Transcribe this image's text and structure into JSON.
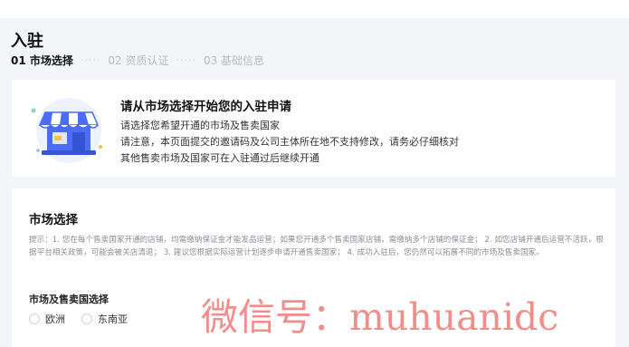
{
  "header": {
    "title": "入驻",
    "steps": [
      {
        "label": "01 市场选择",
        "active": true
      },
      {
        "label": "02 资质认证",
        "active": false
      },
      {
        "label": "03 基础信息",
        "active": false
      }
    ],
    "step_separator": "·····"
  },
  "intro": {
    "heading": "请从市场选择开始您的入驻申请",
    "lines": [
      "请选择您希望开通的市场及售卖国家",
      "请注意，本页面提交的邀请码及公司主体所在地不支持修改，请务必仔细核对",
      "其他售卖市场及国家可在入驻通过后继续开通"
    ],
    "illustration": "storefront-icon"
  },
  "market": {
    "title": "市场选择",
    "hint": "提示：1. 您在每个售卖国家开通的店铺，均需缴纳保证金才能发品运营；如果您开通多个售卖国家店铺，需缴纳多个店铺的保证金； 2. 如您店铺开通后运营不活跃，根据平台相关政策，可能会被关店清退； 3. 建议您根据实际运营计划逐步申请开通售卖国家； 4. 成功入驻后，您仍然可以拓展不同的市场及售卖国家。",
    "region_label": "市场及售卖国选择",
    "options": [
      {
        "label": "欧洲",
        "selected": false
      },
      {
        "label": "东南亚",
        "selected": false
      }
    ]
  },
  "watermark": "微信号：muhuanidc",
  "colors": {
    "page_bg": "#f4f5f8",
    "card_bg": "#ffffff",
    "step_inactive": "#b8bbc3",
    "hint_text": "#8a8d94",
    "watermark": "#f08a84",
    "awning_blue": "#4a6cf7"
  }
}
